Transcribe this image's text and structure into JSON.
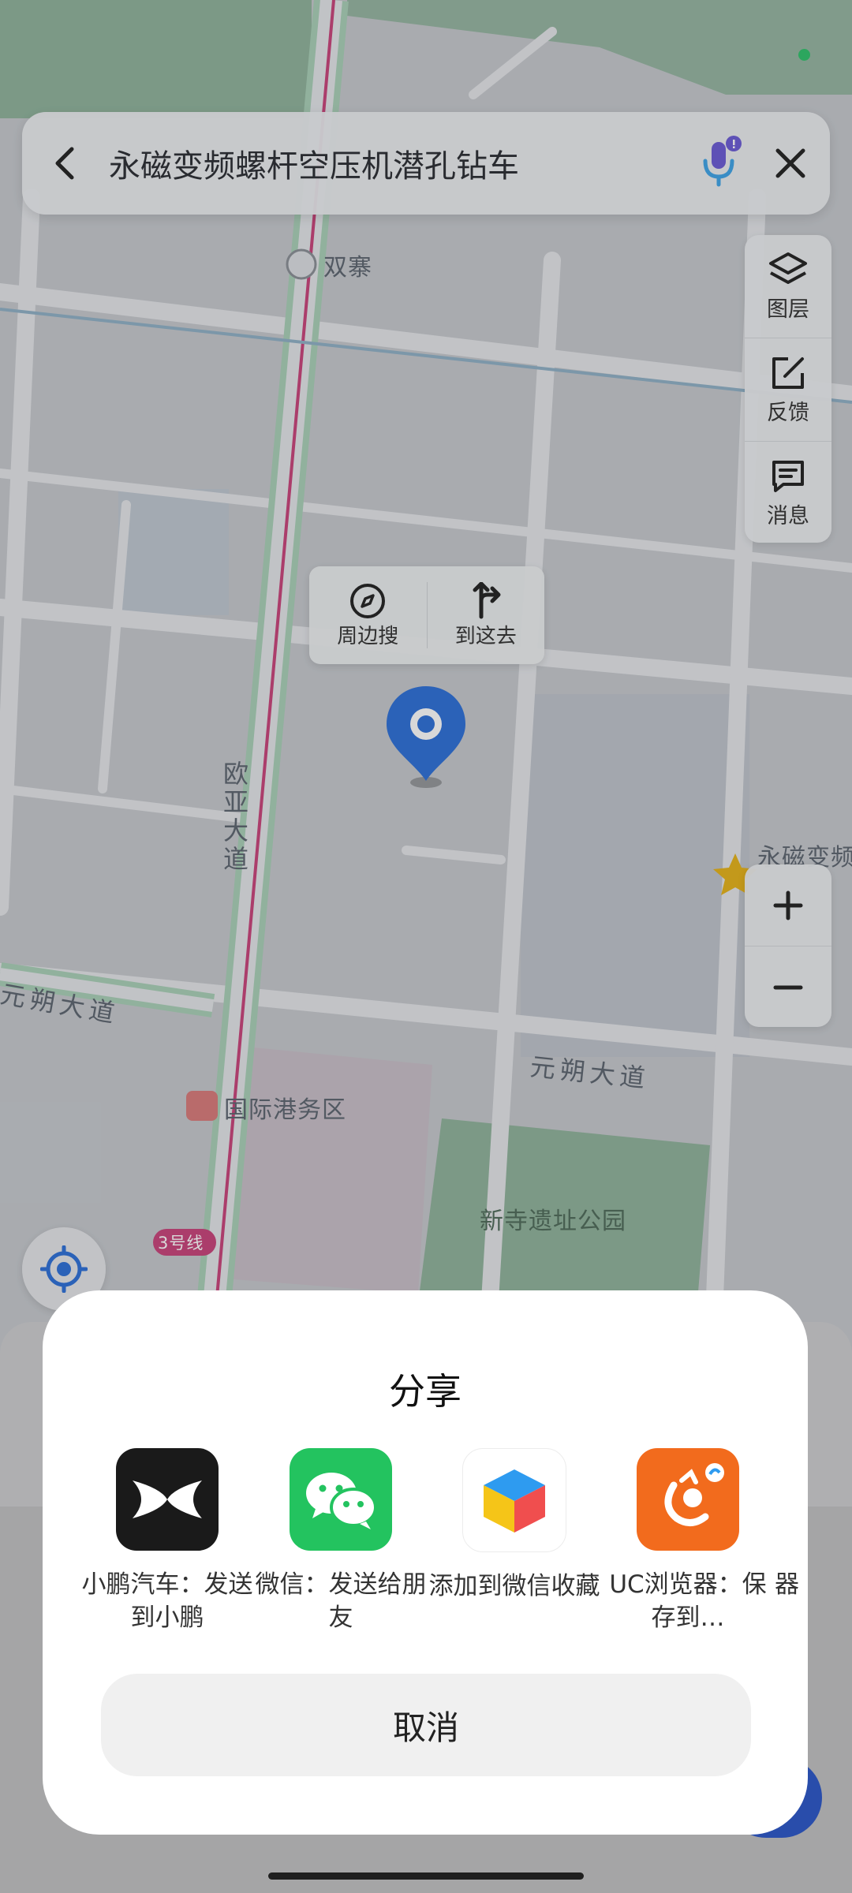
{
  "search": {
    "query": "永磁变频螺杆空压机潜孔钻车"
  },
  "right_panel": {
    "items": [
      {
        "label": "图层",
        "icon": "layers-icon"
      },
      {
        "label": "反馈",
        "icon": "feedback-icon"
      },
      {
        "label": "消息",
        "icon": "message-icon"
      }
    ]
  },
  "popup": {
    "nearby_label": "周边搜",
    "route_label": "到这去"
  },
  "map": {
    "labels": {
      "station_top": "双寨",
      "road_vertical": "欧亚大道",
      "road_left": "元朔大道",
      "road_right": "元朔大道",
      "station_bottom": "国际港务区",
      "park": "新寺遗址公园",
      "metro_line": "3号线",
      "poi_right": "永磁变频"
    },
    "colors": {
      "park": "#8fb39c",
      "road": "#e8eaed",
      "metro": "#c8437a"
    }
  },
  "share": {
    "title": "分享",
    "apps": [
      {
        "label": "小鹏汽车：发送到小鹏",
        "icon": "xpeng-icon",
        "color": "#1a1a1a"
      },
      {
        "label": "微信：发送给朋友",
        "icon": "wechat-icon",
        "color": "#23c35f"
      },
      {
        "label": "添加到微信收藏",
        "icon": "wechat-favorites-icon",
        "color": "#ffffff"
      },
      {
        "label": "UC浏览器：保存到…",
        "icon": "uc-browser-icon",
        "color": "#f26b1d"
      },
      {
        "label": "器",
        "icon": "",
        "color": ""
      }
    ],
    "cancel_label": "取消"
  }
}
